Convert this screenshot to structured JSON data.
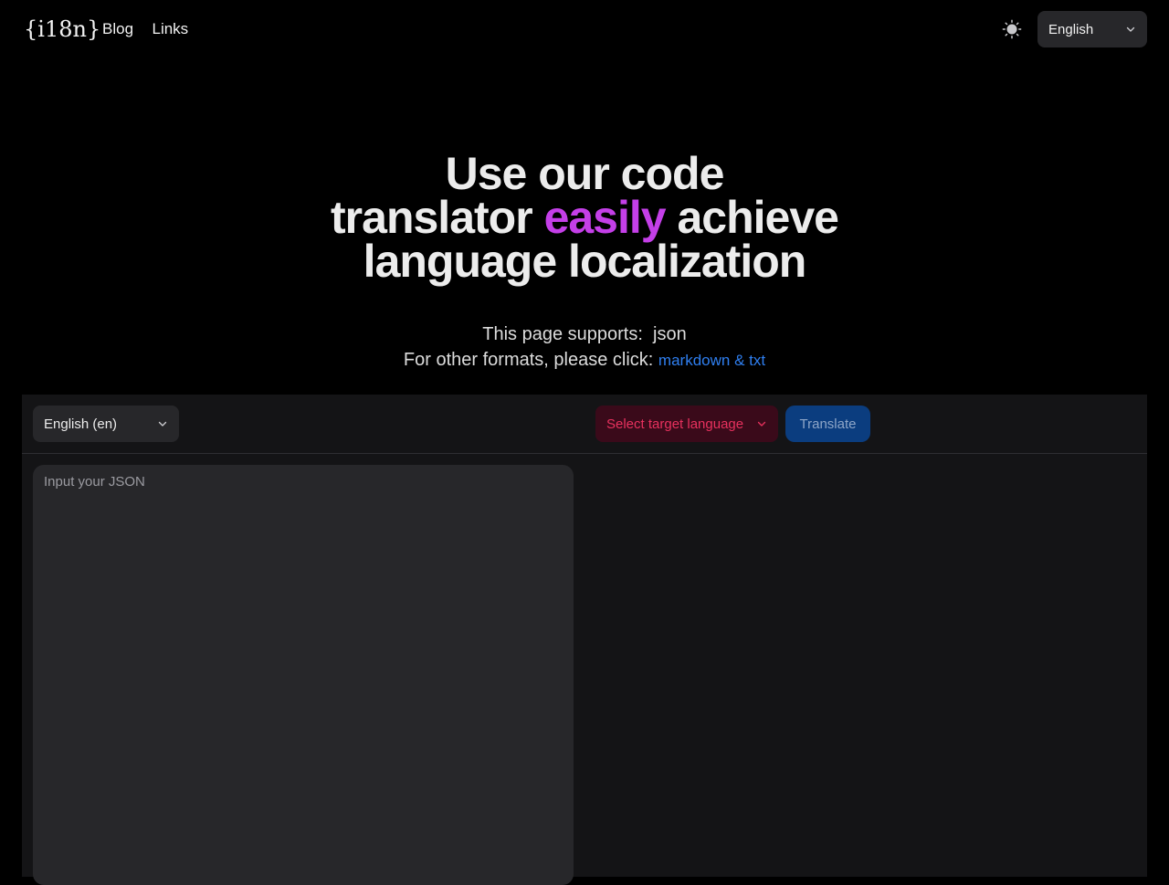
{
  "header": {
    "logo": "{i18n}",
    "nav": [
      "Blog",
      "Links"
    ],
    "language": "English"
  },
  "hero": {
    "line1": "Use our code",
    "line2_pre": "translator",
    "line2_accent": "easily",
    "line2_post": "achieve",
    "line3": "language localization"
  },
  "supports": {
    "line1": "This page supports:  json",
    "line2_prefix": "For other formats, please click:",
    "link": "markdown & txt"
  },
  "workspace": {
    "source_language": "English (en)",
    "target_placeholder": "Select target language",
    "translate_label": "Translate",
    "input_placeholder": "Input your JSON"
  },
  "colors": {
    "accent": "#c43fe8",
    "link": "#2f7ff0",
    "target_text": "#e8315e",
    "translate_bg": "#0b3d7f"
  },
  "icons": {
    "theme": "sun-icon",
    "dropdown": "chevron-down-icon"
  }
}
